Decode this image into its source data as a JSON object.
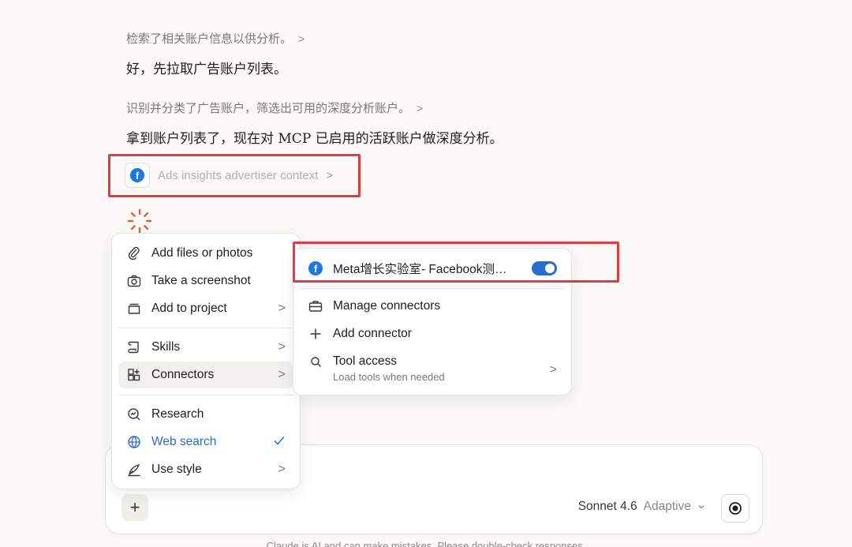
{
  "conversation": {
    "step1": "检索了相关账户信息以供分析。",
    "msg1": "好，先拉取广告账户列表。",
    "step2": "识别并分类了广告账户，筛选出可用的深度分析账户。",
    "msg2": "拿到账户列表了，现在对 MCP 已启用的活跃账户做深度分析。",
    "tool_chip": "Ads insights advertiser context",
    "chevron": ">"
  },
  "menu": {
    "add_files": "Add files or photos",
    "screenshot": "Take a screenshot",
    "add_project": "Add to project",
    "skills": "Skills",
    "connectors": "Connectors",
    "research": "Research",
    "web_search": "Web search",
    "use_style": "Use style"
  },
  "submenu": {
    "connector_name": "Meta增长实验室- Facebook测…",
    "connector_enabled": true,
    "manage": "Manage connectors",
    "add": "Add connector",
    "tool_access": "Tool access",
    "tool_access_sub": "Load tools when needed"
  },
  "composer": {
    "model": "Sonnet 4.6",
    "mode": "Adaptive"
  },
  "footer": {
    "disclaimer": "Claude is AI and can make mistakes. Please double-check responses."
  },
  "colors": {
    "accent_blue": "#2a6bd4",
    "highlight_red": "#e8383d",
    "facebook_blue": "#1877f2",
    "spinner": "#e0603d"
  },
  "icons": {
    "facebook": "facebook-icon",
    "paperclip": "paperclip-icon",
    "camera": "camera-icon",
    "project": "project-icon",
    "skills": "scroll-icon",
    "connectors": "grid-plus-icon",
    "research": "research-icon",
    "globe": "globe-icon",
    "style": "pen-icon",
    "toolbox": "toolbox-icon",
    "plus": "plus-icon",
    "search": "search-icon",
    "record": "record-icon"
  }
}
